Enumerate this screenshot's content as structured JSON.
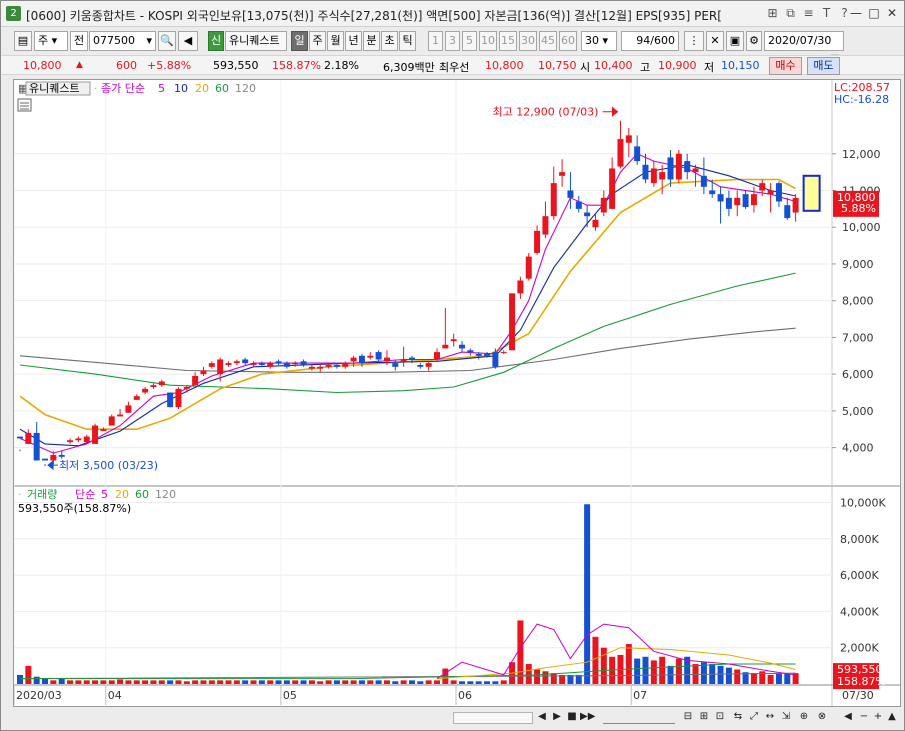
{
  "window": {
    "screen_no": "2",
    "title": "[0600] 키움종합차트 - KOSPI 외국인보유[13,075(천)] 주식수[27,281(천)] 액면[500] 자본금[136(억)] 결산[12월] EPS[935] PER[",
    "title_icons": [
      "layout-icon",
      "copy-icon",
      "settings-icon",
      "font-icon",
      "help-icon"
    ]
  },
  "toolbar": {
    "period_type": "주",
    "market": "전",
    "code": "077500",
    "name_tag": "신",
    "stock_name": "유니퀘스트",
    "period_buttons": [
      "일",
      "주",
      "월",
      "년",
      "분",
      "초",
      "틱"
    ],
    "active_period": "일",
    "interval_buttons": [
      "1",
      "3",
      "5",
      "10",
      "15",
      "30",
      "45",
      "60"
    ],
    "interval_select": "30",
    "count": "94",
    "count_max": "/600",
    "date": "2020/07/30"
  },
  "quote": {
    "price": "10,800",
    "change": "600",
    "change_rate": "+5.88%",
    "volume": "593,550",
    "volume_rate": "158.87%",
    "turnover_rate": "2.18%",
    "amount": "6,309백만",
    "best_ask_label": "최우선",
    "best_ask": "10,800",
    "best_bid": "10,750",
    "open_label": "시",
    "open": "10,400",
    "high_label": "고",
    "high": "10,900",
    "low_label": "저",
    "low": "10,150",
    "buy_label": "매수",
    "sell_label": "매도"
  },
  "price_panel": {
    "stock_label": "유니퀘스트",
    "indicator_label": "종가 단순",
    "ma_periods": [
      "5",
      "10",
      "20",
      "60",
      "120"
    ],
    "lc_label": "LC:208.57",
    "hc_label": "HC:-16.28",
    "high_note": "최고 12,900 (07/03)",
    "low_note": "최저 3,500 (03/23)",
    "price_tag": "10,800",
    "rate_tag": "5.88%"
  },
  "volume_panel": {
    "label": "거래량",
    "indicator_label": "단순",
    "ma_periods": [
      "5",
      "20",
      "60",
      "120"
    ],
    "value_label": "593,550주(158.87%)",
    "value_tag": "593,550",
    "rate_tag": "158.87%"
  },
  "x_axis": {
    "labels": [
      "2020/03",
      "04",
      "05",
      "06",
      "07"
    ],
    "last_label": "07/30"
  },
  "colors": {
    "up": "#e8141e",
    "down": "#1450d2",
    "ma5": "#cc00cc",
    "ma10": "#1428a0",
    "ma20": "#e6aa00",
    "ma60": "#189a3c",
    "ma120": "#6e6e6e"
  },
  "chart_data": {
    "type": "candlestick",
    "price_axis": {
      "ticks": [
        4000,
        5000,
        6000,
        7000,
        8000,
        9000,
        10000,
        11000,
        12000
      ],
      "range": [
        3200,
        13300
      ]
    },
    "volume_axis": {
      "ticks": [
        2000,
        4000,
        6000,
        8000,
        10000
      ],
      "unit": "K",
      "range": [
        0,
        10300
      ]
    },
    "candles": [
      [
        4300,
        4250,
        3950,
        3900
      ],
      [
        4100,
        4400,
        4100,
        4500
      ],
      [
        4400,
        3650,
        3700,
        4700
      ],
      [
        3700,
        3650,
        3550,
        3500
      ],
      [
        3650,
        3800,
        3550,
        3900
      ],
      [
        3800,
        3750,
        3700,
        3900
      ],
      [
        4150,
        4200,
        4100,
        4250
      ],
      [
        4200,
        4250,
        4150,
        4300
      ],
      [
        4150,
        4300,
        4100,
        4350
      ],
      [
        4100,
        4600,
        4100,
        4650
      ],
      [
        4450,
        4500,
        4450,
        4550
      ],
      [
        4600,
        4850,
        4600,
        4900
      ],
      [
        4850,
        4900,
        4850,
        5050
      ],
      [
        4950,
        5150,
        4950,
        5250
      ],
      [
        5300,
        5400,
        5300,
        5450
      ],
      [
        5500,
        5600,
        5450,
        5650
      ],
      [
        5650,
        5700,
        5600,
        5750
      ],
      [
        5700,
        5800,
        5650,
        5850
      ],
      [
        5500,
        5100,
        5500,
        5100
      ],
      [
        5100,
        5600,
        5050,
        5650
      ],
      [
        5600,
        5650,
        5500,
        5700
      ],
      [
        5700,
        5950,
        5700,
        6050
      ],
      [
        6000,
        6100,
        5950,
        6200
      ],
      [
        6200,
        6300,
        6150,
        6350
      ],
      [
        6000,
        6400,
        5800,
        6450
      ],
      [
        6250,
        6300,
        6200,
        6350
      ],
      [
        6300,
        6350,
        6250,
        6400
      ],
      [
        6400,
        6300,
        6250,
        6450
      ],
      [
        6250,
        6300,
        6200,
        6350
      ],
      [
        6300,
        6250,
        6200,
        6350
      ],
      [
        6200,
        6300,
        6150,
        6350
      ],
      [
        6350,
        6300,
        6250,
        6400
      ],
      [
        6300,
        6200,
        6150,
        6350
      ],
      [
        6300,
        6300,
        6200,
        6350
      ],
      [
        6350,
        6250,
        6200,
        6400
      ],
      [
        6150,
        6200,
        6100,
        6250
      ],
      [
        6150,
        6200,
        6050,
        6250
      ],
      [
        6200,
        6250,
        6150,
        6300
      ],
      [
        6250,
        6200,
        6150,
        6300
      ],
      [
        6200,
        6300,
        6150,
        6350
      ],
      [
        6350,
        6450,
        6200,
        6500
      ],
      [
        6500,
        6300,
        6200,
        6550
      ],
      [
        6450,
        6500,
        6400,
        6600
      ],
      [
        6600,
        6400,
        6350,
        6650
      ],
      [
        6350,
        6450,
        6250,
        6650
      ],
      [
        6300,
        6200,
        6100,
        6400
      ],
      [
        6350,
        6400,
        6200,
        6750
      ],
      [
        6450,
        6400,
        6300,
        6500
      ],
      [
        6250,
        6200,
        6150,
        6300
      ],
      [
        6200,
        6300,
        6100,
        6350
      ],
      [
        6400,
        6600,
        6350,
        6700
      ],
      [
        6700,
        6800,
        6700,
        7800
      ],
      [
        6900,
        6950,
        6750,
        7100
      ],
      [
        6800,
        6700,
        6600,
        6900
      ],
      [
        6650,
        6600,
        6500,
        6700
      ],
      [
        6550,
        6500,
        6400,
        6600
      ],
      [
        6550,
        6500,
        6450,
        6600
      ],
      [
        6600,
        6200,
        6150,
        6700
      ],
      [
        6600,
        6600,
        6550,
        6650
      ],
      [
        6650,
        8200,
        6650,
        8200
      ],
      [
        8200,
        8550,
        8050,
        8650
      ],
      [
        8600,
        9200,
        8550,
        9300
      ],
      [
        9300,
        9900,
        9250,
        10050
      ],
      [
        9800,
        10300,
        9700,
        10700
      ],
      [
        10300,
        11200,
        10200,
        11650
      ],
      [
        11400,
        11500,
        11100,
        11850
      ],
      [
        11000,
        10800,
        10500,
        11500
      ],
      [
        10700,
        10500,
        10400,
        10850
      ],
      [
        10400,
        10300,
        10000,
        10600
      ],
      [
        10000,
        10200,
        9900,
        10350
      ],
      [
        10400,
        10800,
        10300,
        11000
      ],
      [
        10500,
        11600,
        10500,
        11900
      ],
      [
        11650,
        12400,
        11600,
        12900
      ],
      [
        12300,
        12500,
        11900,
        12700
      ],
      [
        12200,
        11800,
        11700,
        12500
      ],
      [
        11700,
        11300,
        11200,
        12000
      ],
      [
        11200,
        11600,
        11100,
        11800
      ],
      [
        11300,
        11500,
        10900,
        11700
      ],
      [
        11900,
        11300,
        11100,
        12100
      ],
      [
        11300,
        12000,
        11200,
        12100
      ],
      [
        11800,
        11500,
        11300,
        12000
      ],
      [
        11500,
        11600,
        11100,
        11700
      ],
      [
        11400,
        11100,
        10900,
        11900
      ],
      [
        11000,
        10900,
        10800,
        11300
      ],
      [
        10900,
        10700,
        10100,
        11100
      ],
      [
        10800,
        10500,
        10300,
        11000
      ],
      [
        10600,
        10800,
        10300,
        11000
      ],
      [
        10900,
        10550,
        10500,
        11000
      ],
      [
        10600,
        10900,
        10400,
        11100
      ],
      [
        11000,
        11200,
        10850,
        11300
      ],
      [
        10900,
        11000,
        10400,
        11200
      ],
      [
        11200,
        10700,
        10550,
        11250
      ],
      [
        10600,
        10250,
        10200,
        10800
      ],
      [
        10400,
        10800,
        10150,
        10900
      ]
    ],
    "volumes": [
      500,
      1000,
      400,
      300,
      200,
      300,
      200,
      200,
      200,
      200,
      200,
      200,
      250,
      200,
      200,
      200,
      200,
      200,
      200,
      200,
      150,
      200,
      200,
      200,
      200,
      200,
      200,
      200,
      200,
      200,
      200,
      200,
      200,
      200,
      200,
      200,
      150,
      200,
      200,
      200,
      200,
      200,
      200,
      200,
      200,
      150,
      200,
      200,
      150,
      200,
      200,
      850,
      200,
      150,
      150,
      150,
      150,
      150,
      200,
      1200,
      3500,
      1100,
      800,
      700,
      600,
      500,
      500,
      500,
      9900,
      2600,
      2000,
      1500,
      1600,
      2200,
      1400,
      1500,
      1300,
      1500,
      1000,
      1400,
      1500,
      1100,
      1200,
      1100,
      1000,
      900,
      800,
      650,
      600,
      700,
      500,
      600,
      550,
      600
    ],
    "ma_series": {
      "5": [
        [
          0,
          4250
        ],
        [
          4,
          3850
        ],
        [
          8,
          4100
        ],
        [
          12,
          4600
        ],
        [
          16,
          5400
        ],
        [
          19,
          5500
        ],
        [
          23,
          5950
        ],
        [
          28,
          6300
        ],
        [
          40,
          6300
        ],
        [
          46,
          6400
        ],
        [
          50,
          6400
        ],
        [
          53,
          6600
        ],
        [
          57,
          6550
        ],
        [
          59,
          7200
        ],
        [
          61,
          8000
        ],
        [
          63,
          9400
        ],
        [
          66,
          10800
        ],
        [
          68,
          10600
        ],
        [
          70,
          10600
        ],
        [
          72,
          11500
        ],
        [
          74,
          12000
        ],
        [
          76,
          11800
        ],
        [
          80,
          11600
        ],
        [
          84,
          11100
        ],
        [
          90,
          10900
        ],
        [
          93,
          10700
        ]
      ],
      "10": [
        [
          0,
          4500
        ],
        [
          3,
          4100
        ],
        [
          7,
          4050
        ],
        [
          12,
          4450
        ],
        [
          17,
          5200
        ],
        [
          22,
          5750
        ],
        [
          28,
          6200
        ],
        [
          40,
          6300
        ],
        [
          50,
          6350
        ],
        [
          57,
          6500
        ],
        [
          60,
          7200
        ],
        [
          64,
          8900
        ],
        [
          68,
          10100
        ],
        [
          71,
          10900
        ],
        [
          75,
          11500
        ],
        [
          80,
          11700
        ],
        [
          85,
          11400
        ],
        [
          90,
          11000
        ],
        [
          93,
          10850
        ]
      ],
      "20": [
        [
          0,
          5400
        ],
        [
          3,
          4900
        ],
        [
          8,
          4500
        ],
        [
          14,
          4500
        ],
        [
          18,
          4800
        ],
        [
          24,
          5600
        ],
        [
          29,
          6000
        ],
        [
          37,
          6200
        ],
        [
          47,
          6350
        ],
        [
          56,
          6500
        ],
        [
          61,
          7100
        ],
        [
          66,
          8800
        ],
        [
          72,
          10400
        ],
        [
          78,
          11200
        ],
        [
          86,
          11300
        ],
        [
          91,
          11300
        ],
        [
          93,
          11050
        ]
      ],
      "60": [
        [
          0,
          6250
        ],
        [
          9,
          6000
        ],
        [
          18,
          5700
        ],
        [
          30,
          5600
        ],
        [
          38,
          5500
        ],
        [
          46,
          5550
        ],
        [
          52,
          5650
        ],
        [
          58,
          6050
        ],
        [
          64,
          6700
        ],
        [
          70,
          7300
        ],
        [
          78,
          7900
        ],
        [
          86,
          8400
        ],
        [
          93,
          8750
        ]
      ],
      "120": [
        [
          0,
          6500
        ],
        [
          10,
          6300
        ],
        [
          20,
          6100
        ],
        [
          32,
          6050
        ],
        [
          44,
          6050
        ],
        [
          54,
          6100
        ],
        [
          64,
          6400
        ],
        [
          72,
          6700
        ],
        [
          80,
          6950
        ],
        [
          88,
          7150
        ],
        [
          93,
          7250
        ]
      ]
    },
    "volume_ma": {
      "5": [
        [
          50,
          300
        ],
        [
          53,
          1200
        ],
        [
          58,
          500
        ],
        [
          60,
          2000
        ],
        [
          62,
          3300
        ],
        [
          64,
          3000
        ],
        [
          66,
          1400
        ],
        [
          68,
          2700
        ],
        [
          70,
          3300
        ],
        [
          73,
          3100
        ],
        [
          76,
          1800
        ],
        [
          80,
          1300
        ],
        [
          85,
          1100
        ],
        [
          90,
          700
        ],
        [
          93,
          500
        ]
      ],
      "20": [
        [
          50,
          300
        ],
        [
          59,
          600
        ],
        [
          63,
          900
        ],
        [
          68,
          1200
        ],
        [
          72,
          2000
        ],
        [
          78,
          1900
        ],
        [
          85,
          1600
        ],
        [
          90,
          1150
        ],
        [
          93,
          800
        ]
      ],
      "60": [
        [
          0,
          300
        ],
        [
          40,
          300
        ],
        [
          62,
          500
        ],
        [
          72,
          800
        ],
        [
          85,
          1100
        ],
        [
          93,
          1100
        ]
      ],
      "120": [
        [
          0,
          300
        ],
        [
          70,
          450
        ],
        [
          93,
          600
        ]
      ]
    }
  }
}
